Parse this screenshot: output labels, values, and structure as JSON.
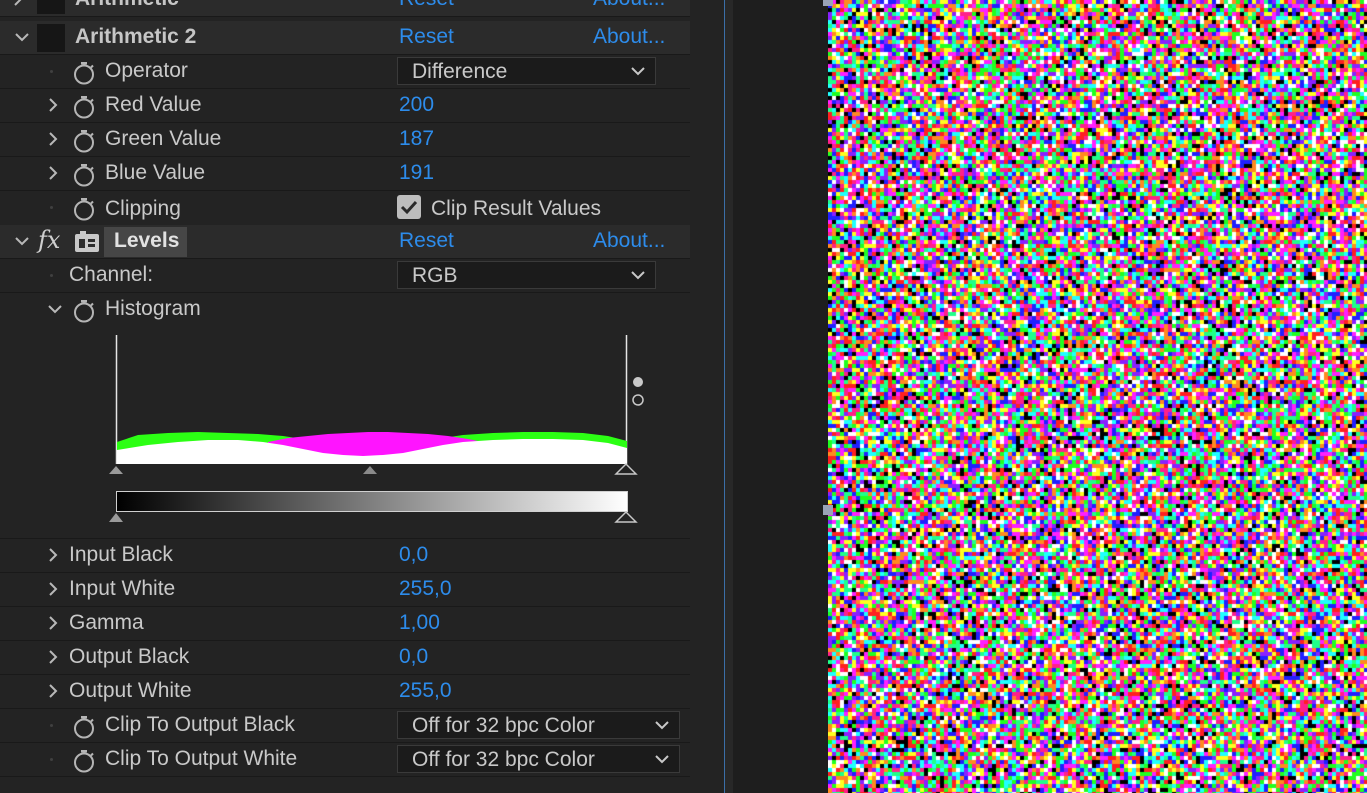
{
  "effects": {
    "arithmetic1": {
      "name": "Arithmetic",
      "reset": "Reset",
      "about": "About..."
    },
    "arithmetic2": {
      "name": "Arithmetic 2",
      "reset": "Reset",
      "about": "About...",
      "operator": {
        "label": "Operator",
        "value": "Difference"
      },
      "red": {
        "label": "Red Value",
        "value": "200"
      },
      "green": {
        "label": "Green Value",
        "value": "187"
      },
      "blue": {
        "label": "Blue Value",
        "value": "191"
      },
      "clipping": {
        "label": "Clipping",
        "checkbox_label": "Clip Result Values",
        "checked": true
      }
    },
    "levels": {
      "fx_glyph": "fx",
      "name": "Levels",
      "reset": "Reset",
      "about": "About...",
      "channel": {
        "label": "Channel:",
        "value": "RGB"
      },
      "histogram": {
        "label": "Histogram"
      },
      "input_black": {
        "label": "Input Black",
        "value": "0,0"
      },
      "input_white": {
        "label": "Input White",
        "value": "255,0"
      },
      "gamma": {
        "label": "Gamma",
        "value": "1,00"
      },
      "output_black": {
        "label": "Output Black",
        "value": "0,0"
      },
      "output_white": {
        "label": "Output White",
        "value": "255,0"
      },
      "clip_black": {
        "label": "Clip To Output Black",
        "value": "Off for 32 bpc Color"
      },
      "clip_white": {
        "label": "Clip To Output White",
        "value": "Off for 32 bpc Color"
      }
    }
  },
  "colors": {
    "accent": "#2d8ceb",
    "panel_bg": "#232323",
    "hist_green": "#2cff14",
    "hist_magenta": "#ff14ff"
  },
  "icons": {
    "stopwatch": "stopwatch-icon",
    "twirl": "chevron-icon",
    "checkbox": "checkmark-icon",
    "dropdown": "chevron-down-icon"
  }
}
